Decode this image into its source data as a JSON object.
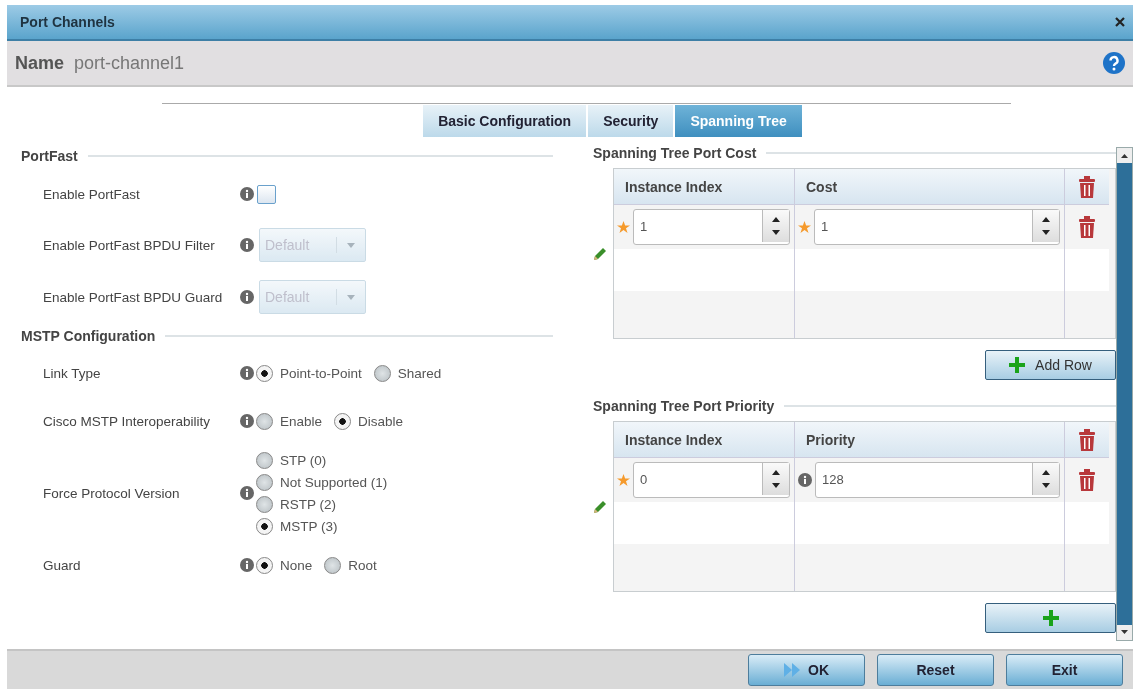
{
  "window": {
    "title": "Port Channels"
  },
  "name": {
    "label": "Name",
    "value": "port-channel1"
  },
  "tabs": [
    {
      "label": "Basic Configuration",
      "selected": false
    },
    {
      "label": "Security",
      "selected": false
    },
    {
      "label": "Spanning Tree",
      "selected": true
    }
  ],
  "portfast": {
    "title": "PortFast",
    "fields": [
      {
        "kind": "checkbox",
        "label": "Enable PortFast",
        "checked": false
      },
      {
        "kind": "select",
        "label": "Enable PortFast BPDU Filter",
        "value": "Default",
        "disabled": true
      },
      {
        "kind": "select",
        "label": "Enable PortFast BPDU Guard",
        "value": "Default",
        "disabled": true
      }
    ]
  },
  "mstp": {
    "title": "MSTP Configuration",
    "fields": [
      {
        "kind": "radio-row",
        "label": "Link Type",
        "options": [
          {
            "label": "Point-to-Point",
            "selected": true
          },
          {
            "label": "Shared",
            "selected": false
          }
        ]
      },
      {
        "kind": "radio-row",
        "label": "Cisco MSTP Interoperability",
        "options": [
          {
            "label": "Enable",
            "selected": false
          },
          {
            "label": "Disable",
            "selected": true
          }
        ]
      },
      {
        "kind": "radio-column",
        "label": "Force Protocol Version",
        "options": [
          {
            "label": "STP (0)",
            "selected": false
          },
          {
            "label": "Not Supported (1)",
            "selected": false
          },
          {
            "label": "RSTP (2)",
            "selected": false
          },
          {
            "label": "MSTP (3)",
            "selected": true
          }
        ]
      },
      {
        "kind": "radio-row",
        "label": "Guard",
        "options": [
          {
            "label": "None",
            "selected": true
          },
          {
            "label": "Root",
            "selected": false
          }
        ]
      }
    ]
  },
  "port_cost": {
    "title": "Spanning Tree Port Cost",
    "columns": [
      "Instance Index",
      "Cost"
    ],
    "rows": [
      {
        "cells": [
          {
            "value": "1",
            "required": true
          },
          {
            "value": "1",
            "required": true
          }
        ]
      }
    ],
    "add_button": "Add Row"
  },
  "port_priority": {
    "title": "Spanning Tree Port Priority",
    "columns": [
      "Instance Index",
      "Priority"
    ],
    "rows": [
      {
        "cells": [
          {
            "value": "0",
            "required": true
          },
          {
            "value": "128",
            "required": false
          }
        ]
      }
    ]
  },
  "footer": {
    "buttons": [
      {
        "kind": "ok",
        "label": "OK"
      },
      {
        "kind": "plain",
        "label": "Reset"
      },
      {
        "kind": "plain",
        "label": "Exit"
      }
    ]
  }
}
